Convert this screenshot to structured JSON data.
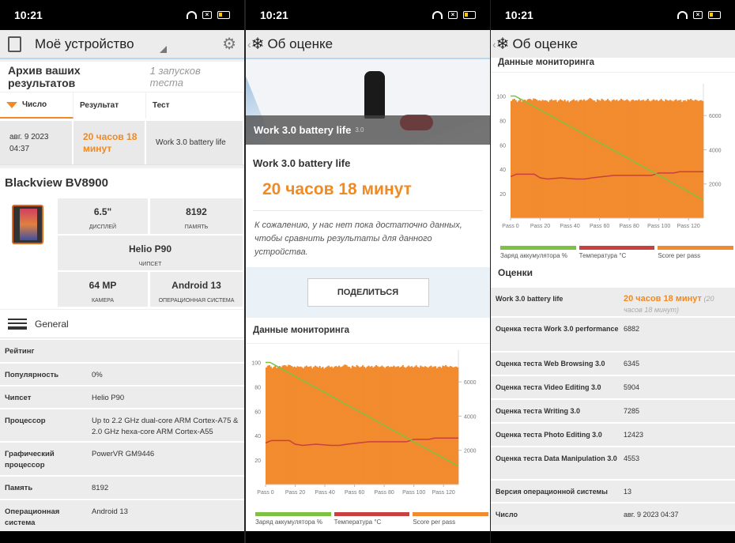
{
  "status": {
    "time": "10:21"
  },
  "panel1": {
    "title": "Моё устройство",
    "archive": {
      "title": "Архив ваших результатов",
      "runs": "1 запусков теста",
      "headers": [
        "Число",
        "Результат",
        "Тест"
      ],
      "row": {
        "date": "авг. 9 2023",
        "time": "04:37",
        "result": "20 часов 18 минут",
        "test": "Work 3.0 battery life"
      }
    },
    "device": {
      "name": "Blackview BV8900",
      "specs": [
        {
          "value": "6.5\"",
          "label": "ДИСПЛЕЙ"
        },
        {
          "value": "8192",
          "label": "ПАМЯТЬ"
        },
        {
          "value": "Helio P90",
          "label": "ЧИПСЕТ"
        },
        {
          "value": "64 MP",
          "label": "КАМЕРА"
        },
        {
          "value": "Android 13",
          "label": "ОПЕРАЦИОННАЯ СИСТЕМА"
        }
      ]
    },
    "general_label": "General",
    "info": [
      {
        "k": "Рейтинг",
        "v": ""
      },
      {
        "k": "Популярность",
        "v": "0%"
      },
      {
        "k": "Чипсет",
        "v": "Helio P90"
      },
      {
        "k": "Процессор",
        "v": "Up to 2.2 GHz dual-core ARM Cortex-A75 & 2.0 GHz hexa-core ARM Cortex-A55"
      },
      {
        "k": "Графический процессор",
        "v": "PowerVR GM9446"
      },
      {
        "k": "Память",
        "v": "8192"
      },
      {
        "k": "Операционная система",
        "v": "Android 13"
      }
    ]
  },
  "panel2": {
    "title": "Об оценке",
    "hero_title": "Work 3.0 battery life",
    "hero_version": "3.0",
    "result_title": "Work 3.0 battery life",
    "result_value": "20 часов 18 минут",
    "note": "К сожалению, у нас нет пока достаточно данных, чтобы сравнить результаты для данного устройства.",
    "share": "ПОДЕЛИТЬСЯ",
    "monitoring": "Данные мониторинга"
  },
  "panel3": {
    "title": "Об оценке",
    "monitoring": "Данные мониторинга",
    "scores_title": "Оценки",
    "scores": [
      {
        "k": "Work 3.0 battery life",
        "v": "20 часов 18 минут",
        "extra": "(20 часов 18 минут)"
      },
      {
        "k": "Оценка теста Work 3.0 performance",
        "v": "6882"
      },
      {
        "k": "Оценка теста Web Browsing 3.0",
        "v": "6345"
      },
      {
        "k": "Оценка теста Video Editing 3.0",
        "v": "5904"
      },
      {
        "k": "Оценка теста Writing 3.0",
        "v": "7285"
      },
      {
        "k": "Оценка теста Photo Editing 3.0",
        "v": "12423"
      },
      {
        "k": "Оценка теста Data Manipulation 3.0",
        "v": "4553"
      },
      {
        "k": "Версия операционной системы",
        "v": "13"
      },
      {
        "k": "Число",
        "v": "авг. 9 2023 04:37"
      }
    ]
  },
  "colors": {
    "accent": "#f08a24",
    "battery": "#7dc242",
    "temperature": "#c8403f",
    "score": "#f28a2e"
  },
  "chart_data": {
    "type": "bar",
    "x_ticks": [
      "Pass 0",
      "Pass 20",
      "Pass 40",
      "Pass 60",
      "Pass 80",
      "Pass 100",
      "Pass 120"
    ],
    "x_range": [
      0,
      130
    ],
    "left_ticks": [
      "100",
      "80",
      "60",
      "40",
      "20"
    ],
    "left_range": [
      0,
      110
    ],
    "right_ticks": [
      "6000",
      "4000",
      "2000"
    ],
    "right_range": [
      0,
      7857
    ],
    "legend": [
      "Заряд аккумулятора %",
      "Температура °C",
      "Score per pass"
    ],
    "score_per_pass": [
      6850,
      6950,
      6980,
      6900,
      6800,
      6880,
      6950,
      6820,
      6900,
      6930,
      6870,
      6950,
      6980,
      6960,
      6900,
      7000,
      6980,
      6930,
      6870,
      6900,
      6850,
      6920,
      6880,
      6900,
      6860,
      6800,
      6900,
      6950,
      6880,
      6900,
      6920,
      6800,
      6880,
      6950,
      6900,
      6850,
      6930,
      6820,
      6880,
      6780,
      6850,
      6900,
      6950,
      6870,
      6900,
      6820,
      6900,
      6930,
      6880,
      6950,
      6870,
      6900,
      6960,
      7020,
      6980,
      6900,
      6880,
      6800,
      6950,
      6900,
      6870,
      6980,
      6920,
      6850,
      6900,
      6970,
      6880,
      6820,
      6900,
      6950,
      6880,
      6930,
      6850,
      6900,
      6980,
      6920,
      6870,
      6900,
      6950,
      6880,
      6820,
      6900,
      6930,
      6870,
      6900,
      6880,
      6950,
      6870,
      6900,
      6920,
      6850,
      6900,
      6980,
      6870,
      6830,
      6900,
      6950,
      6880,
      6920,
      6850,
      6900,
      6970,
      6880,
      6830,
      6950,
      6900,
      6870,
      6920,
      6880,
      6830,
      6900,
      6950,
      6870,
      6900,
      6920,
      6800,
      6880,
      6900,
      6830,
      6950,
      6920,
      6980,
      6900,
      6870,
      6930,
      6900,
      6850,
      6880,
      6900,
      6850
    ],
    "battery_percent": [
      [
        0,
        100
      ],
      [
        3,
        100
      ],
      [
        6,
        98
      ],
      [
        130,
        15
      ]
    ],
    "temperature_c": [
      [
        0,
        34
      ],
      [
        4,
        36
      ],
      [
        16,
        36
      ],
      [
        20,
        33
      ],
      [
        25,
        32
      ],
      [
        34,
        33
      ],
      [
        44,
        32
      ],
      [
        50,
        32
      ],
      [
        55,
        33
      ],
      [
        62,
        34
      ],
      [
        70,
        35
      ],
      [
        85,
        35
      ],
      [
        95,
        35
      ],
      [
        100,
        37
      ],
      [
        110,
        37
      ],
      [
        114,
        38
      ],
      [
        130,
        38
      ]
    ]
  }
}
